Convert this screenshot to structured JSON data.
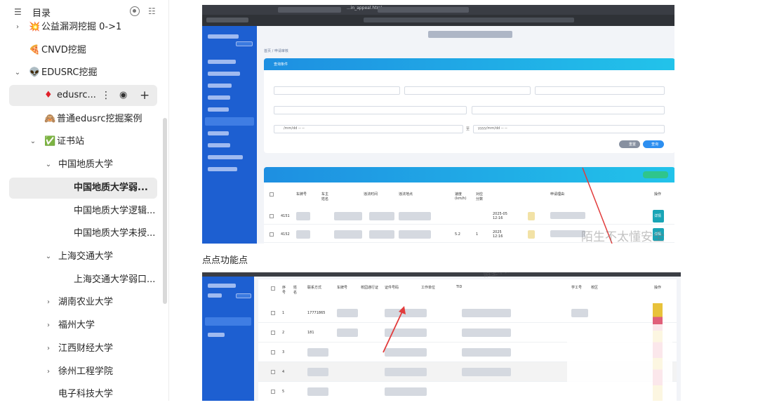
{
  "sidebar": {
    "title": "目录",
    "icons": {
      "toc": "toc-list-icon",
      "locate": "locate-icon",
      "collapse": "collapse-list-icon"
    },
    "items": [
      {
        "label": "公益漏洞挖掘 0->1",
        "emoji": "💥",
        "chevron": "›"
      },
      {
        "label": "CNVD挖掘",
        "emoji": "🍕",
        "chevron": ""
      },
      {
        "label": "EDUSRC挖掘",
        "emoji": "👽",
        "chevron": "⌄"
      },
      {
        "label": "edusrc...",
        "emoji": "♦",
        "chevron": ""
      },
      {
        "label": "普通edusrc挖掘案例",
        "emoji": "🙈",
        "chevron": ""
      },
      {
        "label": "证书站",
        "emoji": "✅",
        "chevron": "⌄"
      },
      {
        "label": "中国地质大学",
        "emoji": "",
        "chevron": "⌄"
      },
      {
        "label": "中国地质大学弱...",
        "emoji": "",
        "chevron": ""
      },
      {
        "label": "中国地质大学逻辑...",
        "emoji": "",
        "chevron": ""
      },
      {
        "label": "中国地质大学未授...",
        "emoji": "",
        "chevron": ""
      },
      {
        "label": "上海交通大学",
        "emoji": "",
        "chevron": "⌄"
      },
      {
        "label": "上海交通大学弱口...",
        "emoji": "",
        "chevron": ""
      },
      {
        "label": "湖南农业大学",
        "emoji": "",
        "chevron": "›"
      },
      {
        "label": "福州大学",
        "emoji": "",
        "chevron": "›"
      },
      {
        "label": "江西财经大学",
        "emoji": "",
        "chevron": "›"
      },
      {
        "label": "徐州工程学院",
        "emoji": "",
        "chevron": "›"
      },
      {
        "label": "电子科技大学",
        "emoji": "",
        "chevron": ""
      }
    ],
    "item_actions": {
      "more": "⋮",
      "preview": "👁",
      "add": "+"
    }
  },
  "main": {
    "caption": "点点功能点",
    "screenshot1": {
      "url": "...in_appeal.html",
      "breadcrumb": "首页 / 申请审核",
      "query_panel_title": "查询条件",
      "date_placeholder_1": "/mm/dd  -- --",
      "date_placeholder_2": "yyyy/mm/dd  -- --",
      "date_separator": "至",
      "reset_label": "重置",
      "query_label": "查询",
      "table_headers": [
        "车牌号",
        "车主姓名",
        "违法时间",
        "违法地点",
        "速度(km/h)",
        "对应分数",
        "申请理由",
        "操作"
      ],
      "rows": [
        {
          "id": "4151",
          "speed": "",
          "score": "",
          "time": "2025-05 12:16",
          "detail": "详情"
        },
        {
          "id": "4152",
          "speed": "5.2",
          "score": "1",
          "time": "2025 12:16",
          "detail": "详情"
        }
      ],
      "watermark": "陌生不太懂安全"
    },
    "screenshot2": {
      "table_headers": [
        "序号",
        "姓名",
        "联系方式",
        "车牌号",
        "校园通行证",
        "证件号码",
        "工作单位",
        "TID",
        "学工号",
        "校区",
        "操作"
      ],
      "rows": [
        {
          "no": "1",
          "phone": "17771865"
        },
        {
          "no": "2",
          "phone": "181"
        },
        {
          "no": "3",
          "phone": ""
        },
        {
          "no": "4",
          "phone": ""
        },
        {
          "no": "5",
          "phone": ""
        }
      ],
      "watermark": "陌生不太懂安全"
    }
  },
  "colors": {
    "accent_blue": "#1d5fd1",
    "cyan": "#22c3ea",
    "arrow_red": "#e23b3b"
  }
}
